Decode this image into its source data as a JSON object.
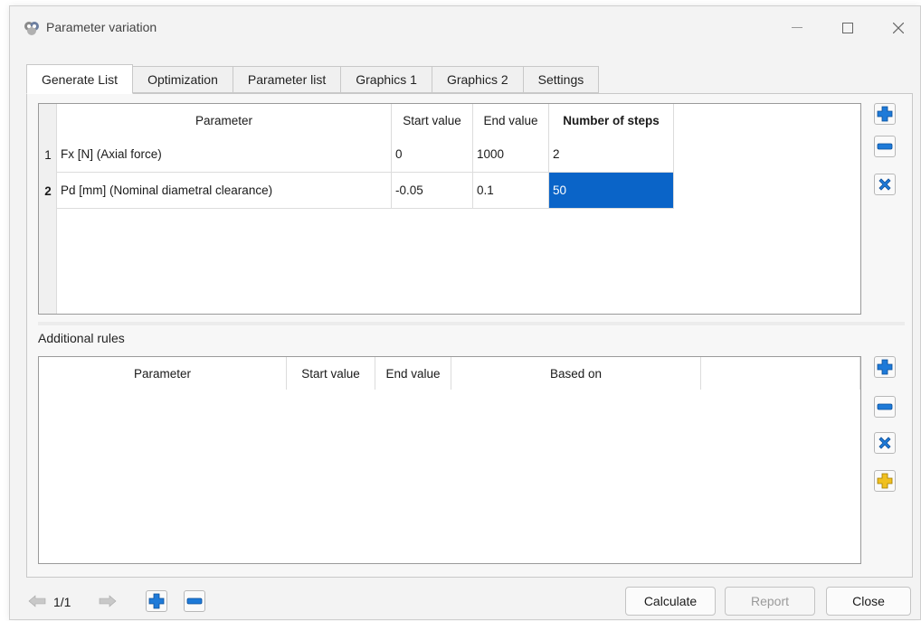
{
  "window": {
    "title": "Parameter variation",
    "icons": {
      "app": "parameter-variation-icon",
      "minimize": "minimize-icon",
      "maximize": "maximize-icon",
      "close": "close-icon"
    }
  },
  "tabs": [
    {
      "label": "Generate List",
      "active": true
    },
    {
      "label": "Optimization",
      "active": false
    },
    {
      "label": "Parameter list",
      "active": false
    },
    {
      "label": "Graphics 1",
      "active": false
    },
    {
      "label": "Graphics 2",
      "active": false
    },
    {
      "label": "Settings",
      "active": false
    }
  ],
  "parameters_table": {
    "headers": {
      "parameter": "Parameter",
      "start": "Start value",
      "end": "End value",
      "steps": "Number of steps"
    },
    "rows": [
      {
        "num": "1",
        "parameter": "Fx [N]  (Axial force)",
        "start": "0",
        "end": "1000",
        "steps": "2"
      },
      {
        "num": "2",
        "parameter": "Pd [mm]  (Nominal diametral clearance)",
        "start": "-0.05",
        "end": "0.1",
        "steps": "50"
      }
    ],
    "selected_cell": "row 2, Number of steps"
  },
  "additional_rules": {
    "label": "Additional rules",
    "headers": {
      "parameter": "Parameter",
      "start": "Start value",
      "end": "End value",
      "based_on": "Based on",
      "extra": ""
    }
  },
  "footer": {
    "page_indicator": "1/1",
    "calculate": "Calculate",
    "report": "Report",
    "close": "Close"
  },
  "colors": {
    "selection": "#0a64c8",
    "plus_blue": "#1e7ad8",
    "plus_yellow": "#f0c020"
  }
}
